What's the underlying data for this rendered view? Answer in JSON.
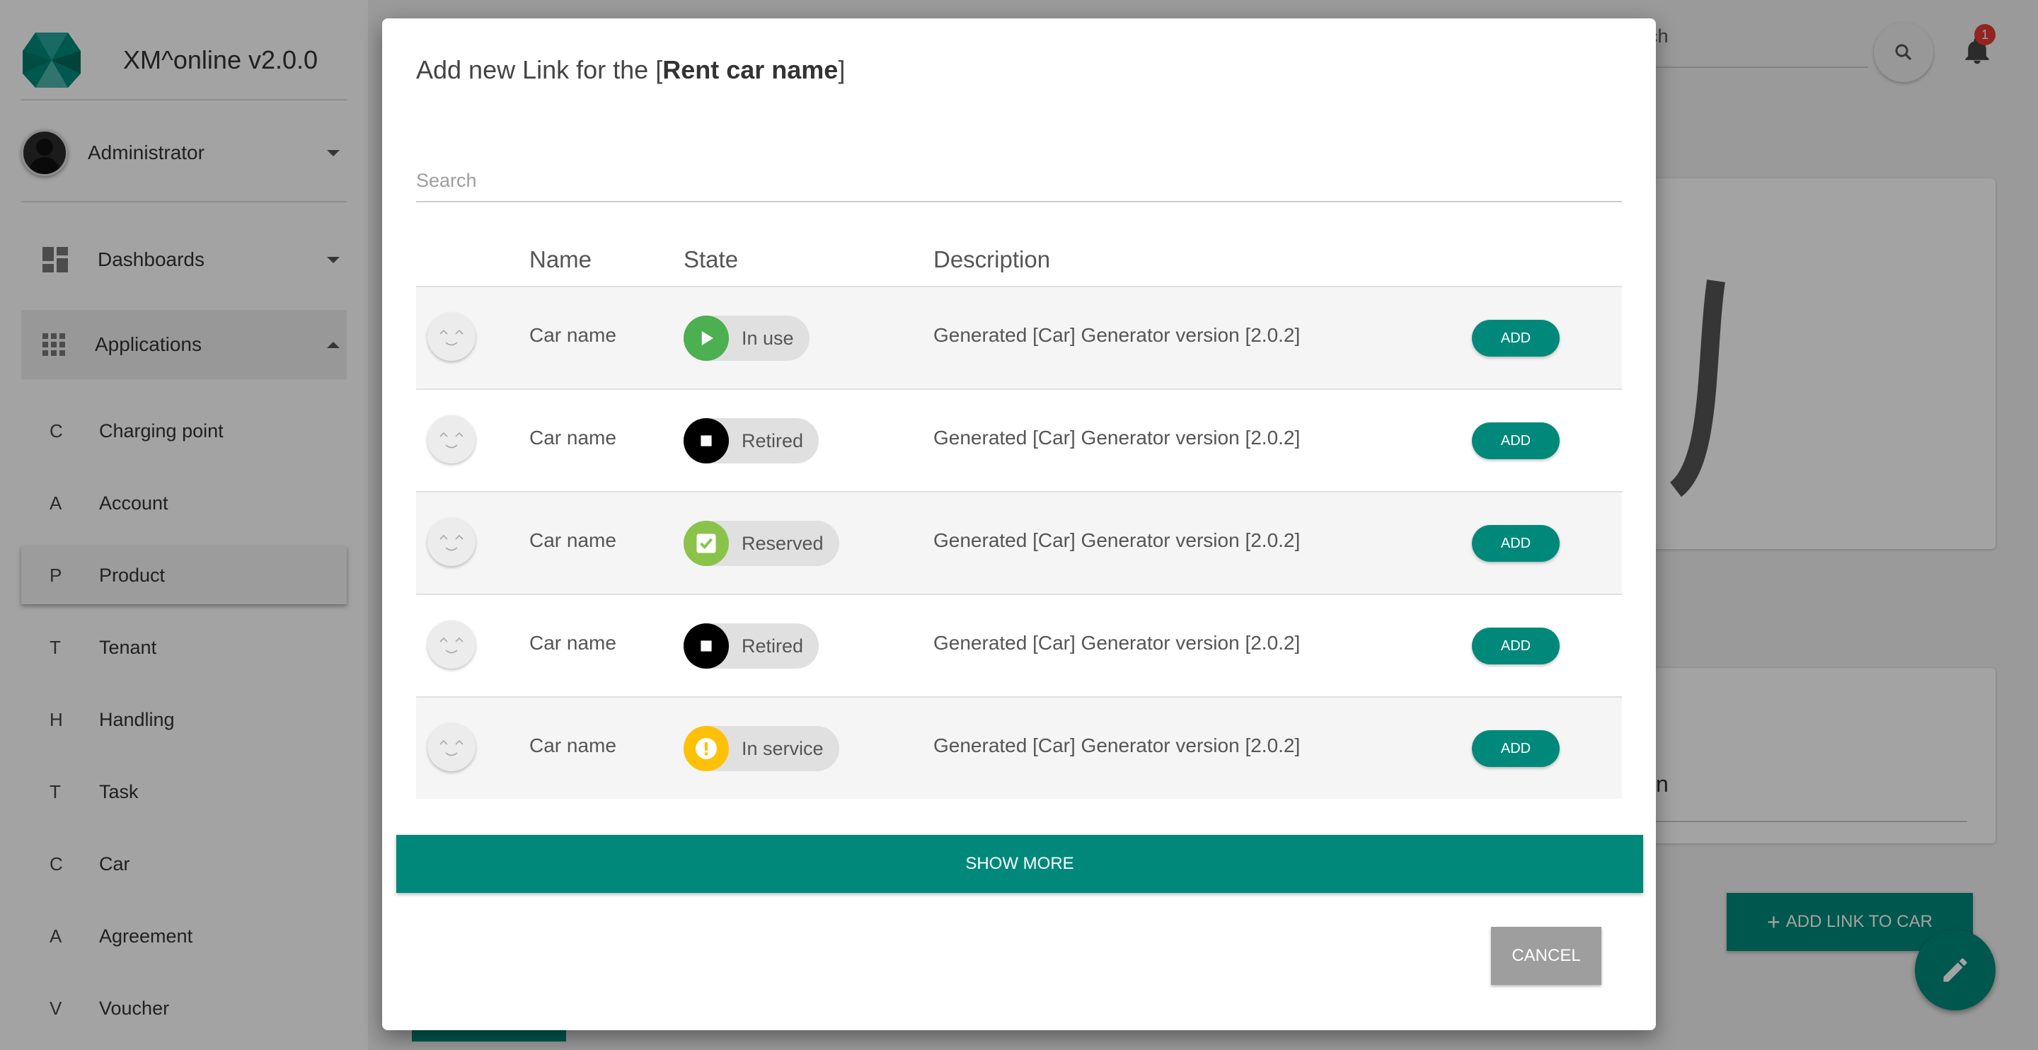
{
  "app": {
    "title": "XM^online v2.0.0"
  },
  "user": {
    "name": "Administrator"
  },
  "nav": {
    "dashboards": "Dashboards",
    "applications": "Applications",
    "items": [
      {
        "letter": "C",
        "label": "Charging point"
      },
      {
        "letter": "A",
        "label": "Account"
      },
      {
        "letter": "P",
        "label": "Product"
      },
      {
        "letter": "T",
        "label": "Tenant"
      },
      {
        "letter": "H",
        "label": "Handling"
      },
      {
        "letter": "T",
        "label": "Task"
      },
      {
        "letter": "C",
        "label": "Car"
      },
      {
        "letter": "A",
        "label": "Agreement"
      },
      {
        "letter": "V",
        "label": "Voucher"
      }
    ]
  },
  "header": {
    "search_text": "earch",
    "notification_count": "1"
  },
  "background": {
    "card_text": "n",
    "add_link_label": "ADD LINK TO CAR"
  },
  "dialog": {
    "title_prefix": "Add new Link for the [",
    "title_entity": "Rent car name",
    "title_suffix": "]",
    "search_placeholder": "Search",
    "columns": {
      "name": "Name",
      "state": "State",
      "description": "Description"
    },
    "rows": [
      {
        "name": "Car name",
        "state": "In use",
        "description": "Generated [Car] Generator version [2.0.2]",
        "action": "ADD"
      },
      {
        "name": "Car name",
        "state": "Retired",
        "description": "Generated [Car] Generator version [2.0.2]",
        "action": "ADD"
      },
      {
        "name": "Car name",
        "state": "Reserved",
        "description": "Generated [Car] Generator version [2.0.2]",
        "action": "ADD"
      },
      {
        "name": "Car name",
        "state": "Retired",
        "description": "Generated [Car] Generator version [2.0.2]",
        "action": "ADD"
      },
      {
        "name": "Car name",
        "state": "In service",
        "description": "Generated [Car] Generator version [2.0.2]",
        "action": "ADD"
      }
    ],
    "show_more": "SHOW MORE",
    "cancel": "CANCEL"
  },
  "colors": {
    "accent": "#00897b",
    "in_use": "#4caf50",
    "retired": "#000000",
    "reserved": "#8bc34a",
    "in_service": "#ffc107",
    "badge": "#e53935"
  }
}
